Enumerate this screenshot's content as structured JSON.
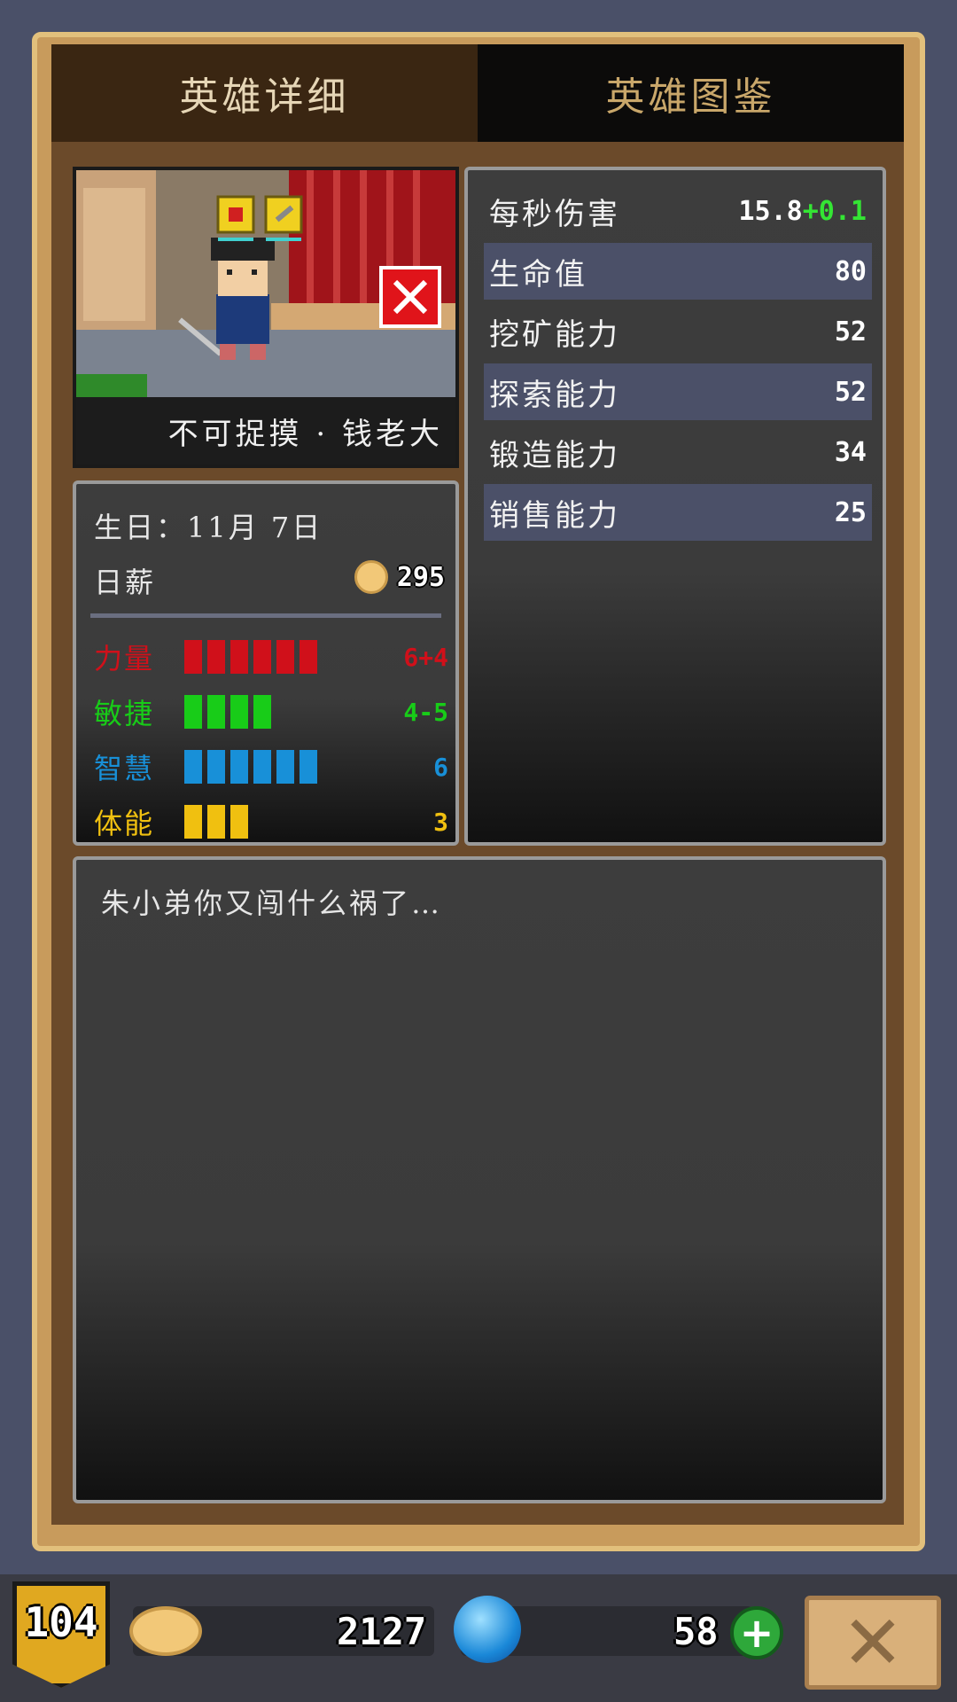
{
  "tabs": {
    "detail": "英雄详细",
    "codex": "英雄图鉴"
  },
  "hero": {
    "name": "不可捉摸 · 钱老大",
    "birthday_label": "生日：",
    "birthday_value": "11月 7日",
    "salary_label": "日薪",
    "salary_value": "295"
  },
  "stats": [
    {
      "label": "每秒伤害",
      "value": "15.8",
      "bonus": "+0.1"
    },
    {
      "label": "生命值",
      "value": "80"
    },
    {
      "label": "挖矿能力",
      "value": "52"
    },
    {
      "label": "探索能力",
      "value": "52"
    },
    {
      "label": "锻造能力",
      "value": "34"
    },
    {
      "label": "销售能力",
      "value": "25"
    }
  ],
  "attributes": [
    {
      "label": "力量",
      "bars": 6,
      "value": "6+4",
      "color": "#d0101a"
    },
    {
      "label": "敏捷",
      "bars": 4,
      "value": "4-5",
      "color": "#18cc18"
    },
    {
      "label": "智慧",
      "bars": 6,
      "value": "6",
      "color": "#1890d8"
    },
    {
      "label": "体能",
      "bars": 3,
      "value": "3",
      "color": "#f0c010"
    }
  ],
  "description": "朱小弟你又闯什么祸了…",
  "footer": {
    "level": "104",
    "gold": "2127",
    "gems": "58"
  },
  "colors": {
    "bonus_green": "#34e534",
    "row_highlight": "#4b5068",
    "frame_gold": "#c89b5c"
  }
}
